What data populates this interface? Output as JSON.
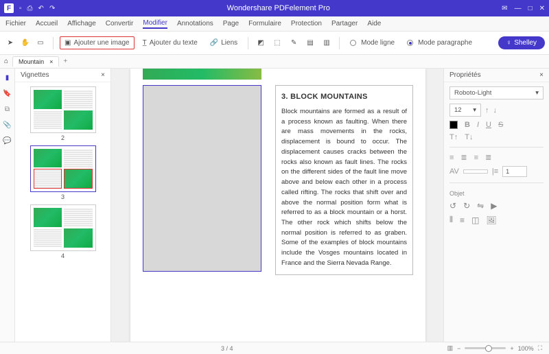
{
  "app": {
    "title": "Wondershare PDFelement Pro",
    "logo": "F"
  },
  "menu": {
    "items": [
      "Fichier",
      "Accueil",
      "Affichage",
      "Convertir",
      "Modifier",
      "Annotations",
      "Page",
      "Formulaire",
      "Protection",
      "Partager",
      "Aide"
    ],
    "active": 4
  },
  "toolbar": {
    "add_image": "Ajouter une image",
    "add_text": "Ajouter du texte",
    "links": "Liens",
    "mode_line": "Mode ligne",
    "mode_para": "Mode paragraphe",
    "user": "Shelley"
  },
  "tab": {
    "name": "Mountain",
    "close": "×",
    "add": "+"
  },
  "thumbs": {
    "title": "Vignettes",
    "close": "×",
    "pages": [
      2,
      3,
      4
    ],
    "current": 3
  },
  "doc": {
    "heading": "3. BLOCK MOUNTAINS",
    "body": "Block mountains are formed as a result of a process known as faulting. When there are mass movements in the rocks, displacement is bound to occur. The displacement causes cracks between the rocks also known as fault lines. The rocks on the different sides of the fault line move above and below each other in a process called rifting. The rocks that shift over and above the normal position form what is referred to as a block mountain or a horst. The other rock which shifts below the normal position is referred to as graben. Some of the examples of block mountains include the Vosges mountains located in France and the Sierra Nevada Range."
  },
  "props": {
    "title": "Propriétés",
    "close": "×",
    "font": "Roboto-Light",
    "size": "12",
    "line_spacing_label": "1",
    "object_label": "Objet"
  },
  "status": {
    "page": "3 / 4",
    "zoom": "100%"
  }
}
